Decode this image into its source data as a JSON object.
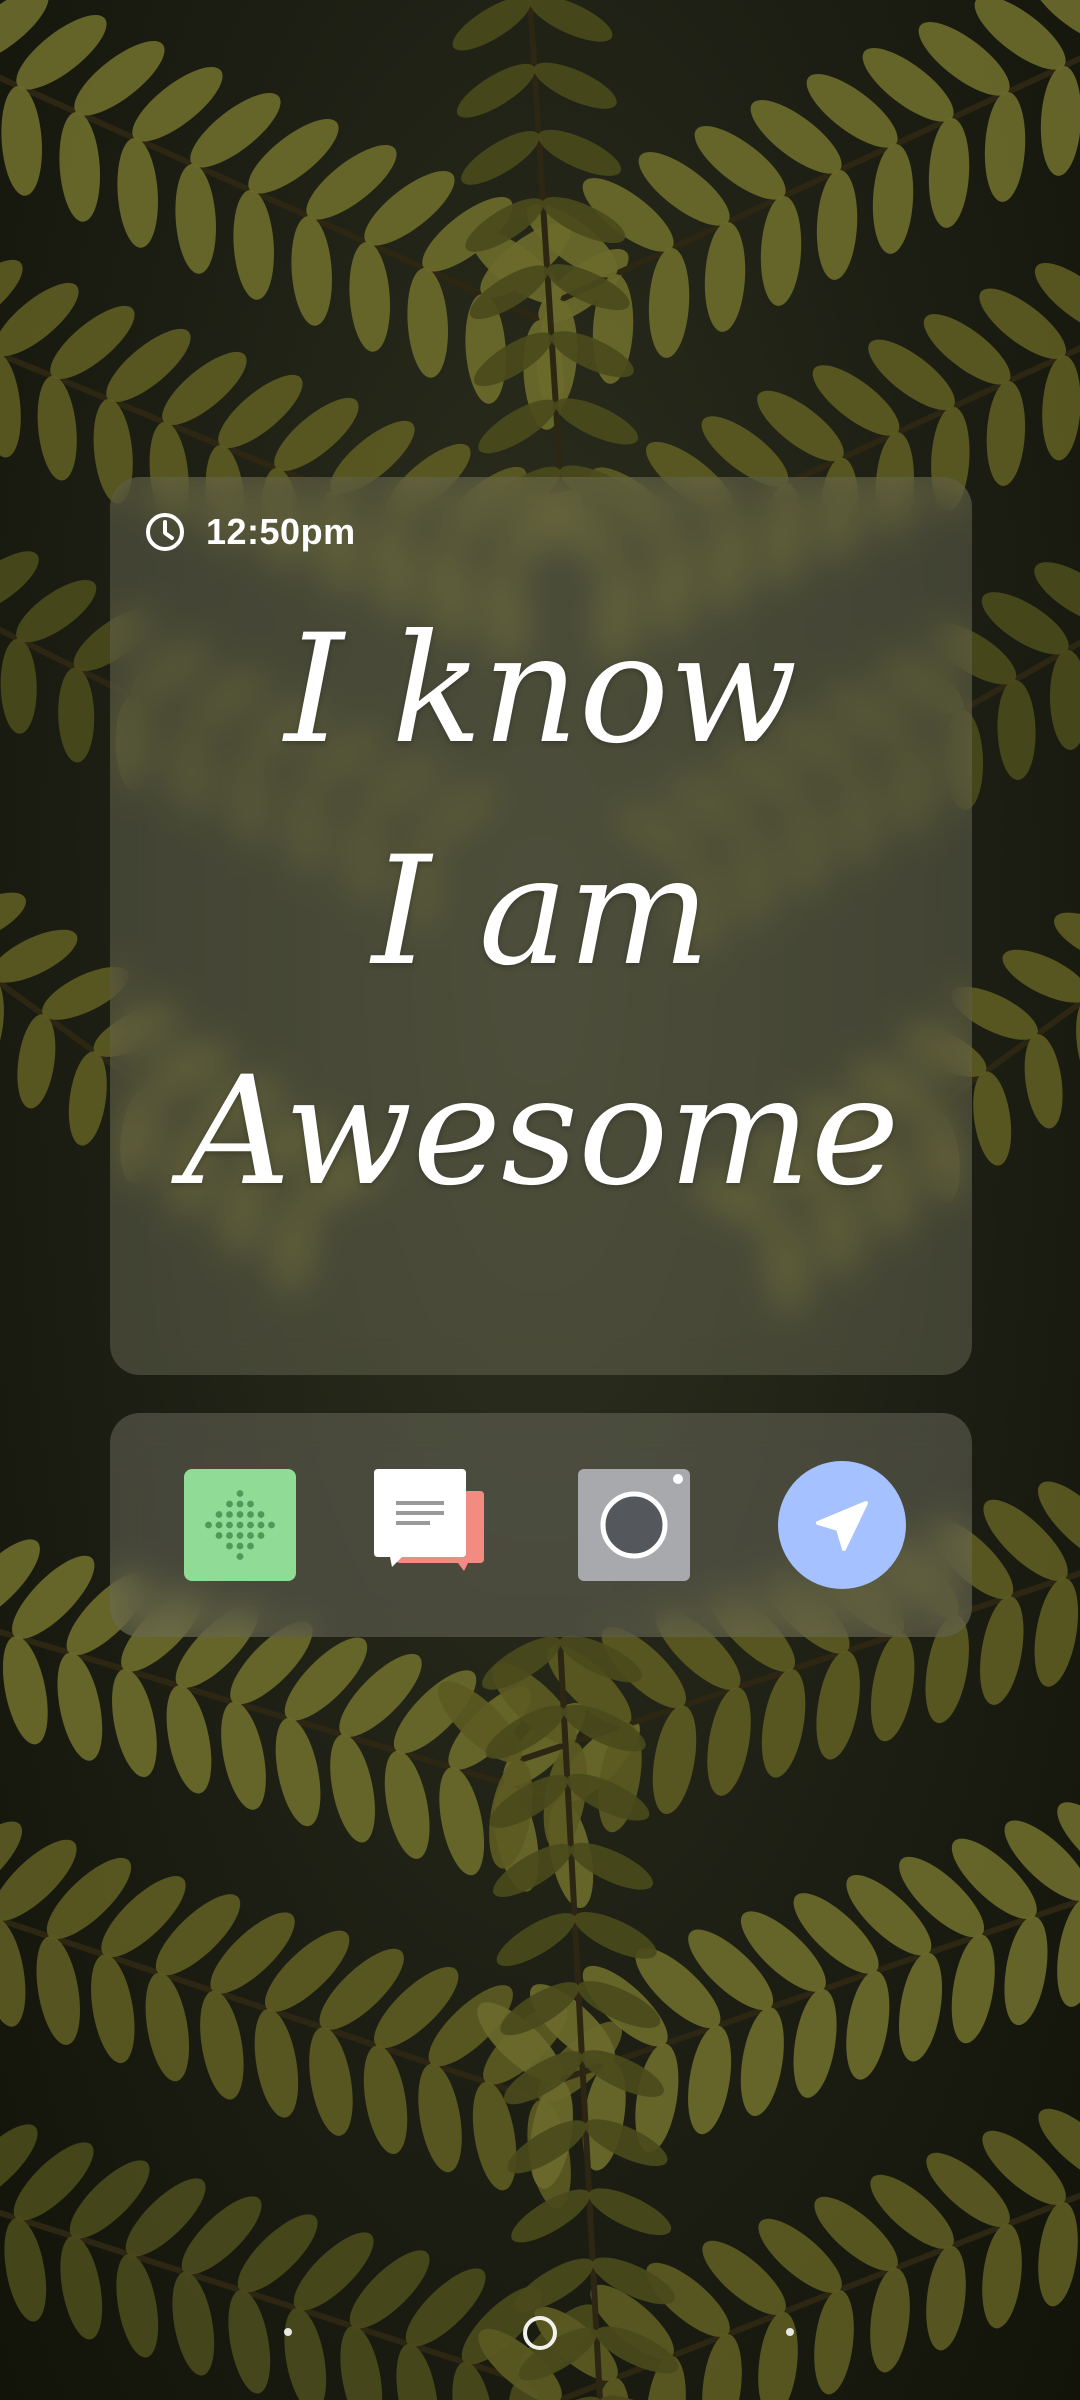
{
  "quote_widget": {
    "time": "12:50pm",
    "clock_icon": "clock-icon",
    "lines": [
      "I know",
      "I am",
      "Awesome"
    ]
  },
  "dock": {
    "apps": [
      {
        "icon": "dot-grid-app-icon",
        "color": "#90dc96"
      },
      {
        "icon": "chat-notes-app-icon",
        "color": "#f28b82"
      },
      {
        "icon": "camera-app-icon",
        "color": "#a8a9ad"
      },
      {
        "icon": "navigation-app-icon",
        "color": "#a6c1ff"
      }
    ]
  },
  "nav_bar": {
    "icons": [
      "recents-dot-icon",
      "home-circle-icon",
      "back-dot-icon"
    ]
  }
}
